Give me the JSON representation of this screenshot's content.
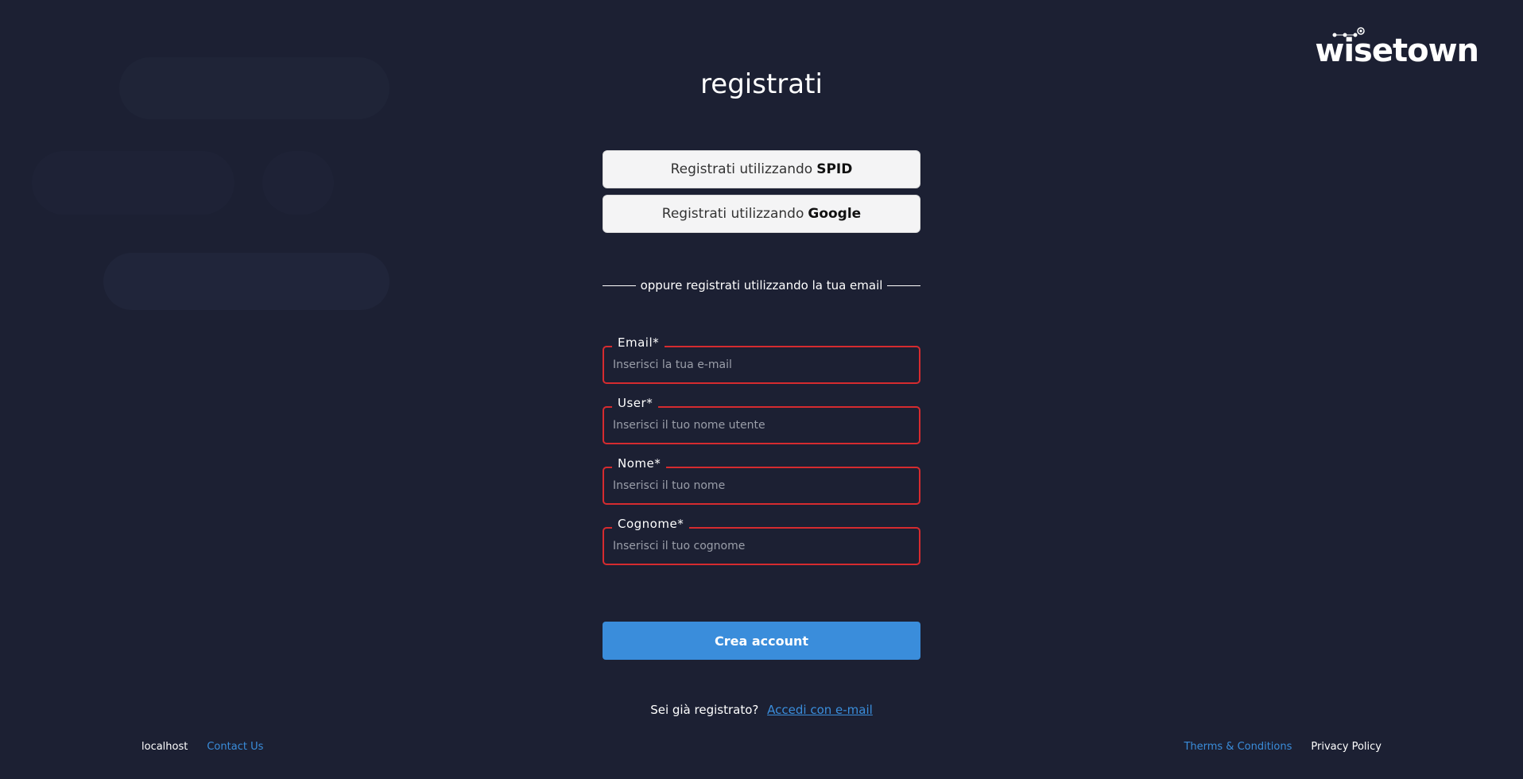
{
  "brand": {
    "logo_text": "wisetown"
  },
  "page_title": "registrati",
  "social": {
    "spid": {
      "prefix": "Registrati utilizzando",
      "provider": "SPID"
    },
    "google": {
      "prefix": "Registrati utilizzando",
      "provider": "Google"
    }
  },
  "divider_text": "oppure registrati utilizzando la tua email",
  "form": {
    "email": {
      "label": "Email*",
      "value": "",
      "placeholder": "Inserisci la tua e-mail"
    },
    "user": {
      "label": "User*",
      "value": "",
      "placeholder": "Inserisci il tuo nome utente"
    },
    "nome": {
      "label": "Nome*",
      "value": "",
      "placeholder": "Inserisci il tuo nome"
    },
    "cognome": {
      "label": "Cognome*",
      "value": "",
      "placeholder": "Inserisci il tuo cognome"
    }
  },
  "create_button": "Crea account",
  "login": {
    "question": "Sei già registrato?",
    "link": "Accedi con e-mail"
  },
  "footer": {
    "host": "localhost",
    "contact": "Contact Us",
    "terms": "Therms & Conditions",
    "privacy": "Privacy Policy"
  },
  "colors": {
    "background": "#1c2033",
    "error_border": "#d52b2f",
    "accent": "#3a8ddb",
    "social_button_bg": "#f4f4f5"
  }
}
